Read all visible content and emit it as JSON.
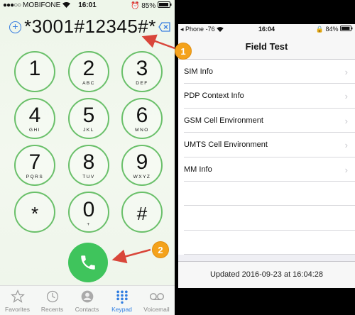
{
  "left_phone": {
    "status": {
      "carrier": "MOBIFONE",
      "time": "16:01",
      "battery": "85%"
    },
    "dial_number": "*3001#12345#*",
    "keys": [
      {
        "digit": "1",
        "letters": ""
      },
      {
        "digit": "2",
        "letters": "ABC"
      },
      {
        "digit": "3",
        "letters": "DEF"
      },
      {
        "digit": "4",
        "letters": "GHI"
      },
      {
        "digit": "5",
        "letters": "JKL"
      },
      {
        "digit": "6",
        "letters": "MNO"
      },
      {
        "digit": "7",
        "letters": "PQRS"
      },
      {
        "digit": "8",
        "letters": "TUV"
      },
      {
        "digit": "9",
        "letters": "WXYZ"
      },
      {
        "digit": "*",
        "letters": ""
      },
      {
        "digit": "0",
        "letters": "+"
      },
      {
        "digit": "#",
        "letters": ""
      }
    ],
    "tabs": [
      "Favorites",
      "Recents",
      "Contacts",
      "Keypad",
      "Voicemail"
    ],
    "active_tab": "Keypad"
  },
  "annotations": {
    "badge1": "1",
    "badge2": "2",
    "color": "#f4a21b",
    "arrow_color": "#d9463a"
  },
  "right_phone": {
    "status": {
      "back": "Phone",
      "signal": "-76",
      "time": "16:04",
      "battery": "84%"
    },
    "title": "Field Test",
    "items": [
      "SIM Info",
      "PDP Context Info",
      "GSM Cell Environment",
      "UMTS Cell Environment",
      "MM Info"
    ],
    "footer": "Updated 2016-09-23 at 16:04:28"
  },
  "colors": {
    "accent": "#2f7de1",
    "key_ring": "#6ac06a",
    "call": "#3fc45c"
  }
}
